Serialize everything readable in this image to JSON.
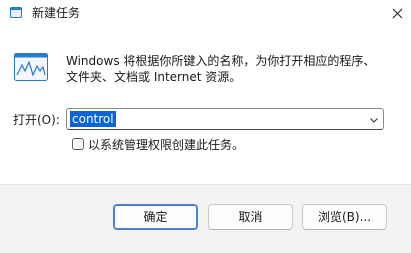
{
  "window": {
    "title": "新建任务"
  },
  "description": {
    "line1": "Windows 将根据你所键入的名称，为你打开相应的程序、",
    "line2": "文件夹、文档或 Internet 资源。"
  },
  "open": {
    "label": "打开(O):",
    "value": "control"
  },
  "admin_checkbox": {
    "label": "以系统管理权限创建此任务。",
    "checked": false
  },
  "buttons": {
    "ok": "确定",
    "cancel": "取消",
    "browse": "浏览(B)..."
  },
  "colors": {
    "selection": "#0a64d8",
    "button_bar": "#f3f3f3",
    "primary_border": "#4a7fd1",
    "icon_blue": "#2b78d0"
  },
  "icons": {
    "title": "run-dialog-icon",
    "app": "run-program-icon",
    "close": "close-icon",
    "dropdown": "chevron-down-icon"
  }
}
